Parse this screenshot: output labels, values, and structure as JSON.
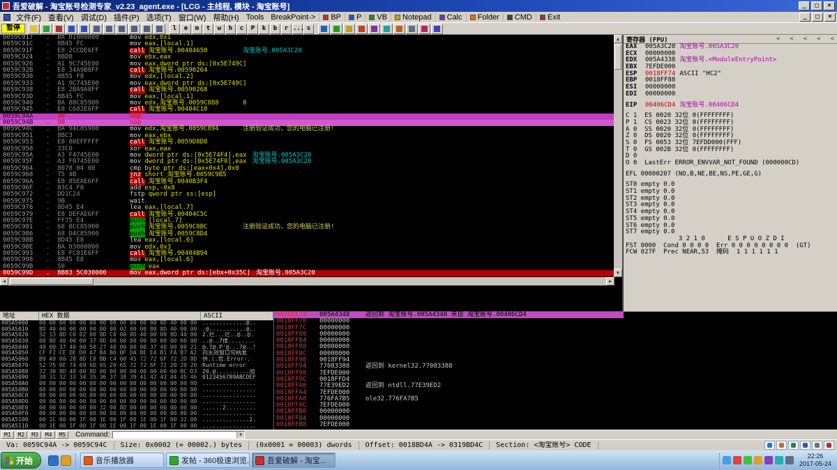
{
  "titlebar": {
    "title": "吾爱破解 - 淘宝账号检测专家_v2.23_agent.exe - [LCG - 主线程, 模块 - 淘宝账号]",
    "controls": [
      "_",
      "□",
      "×"
    ]
  },
  "menubar": {
    "menus": [
      "文件(F)",
      "查看(V)",
      "调试(D)",
      "插件(P)",
      "选项(T)",
      "窗口(W)",
      "帮助(H)",
      "Tools",
      "BreakPoint->"
    ],
    "shortcuts": [
      "BP",
      "P",
      "VB",
      "Notepad",
      "Calc",
      "Folder",
      "CMD",
      "Exit"
    ],
    "controls": [
      "_",
      "□",
      "×"
    ]
  },
  "toolbar": {
    "state_label": "暂停",
    "nav_icons": [
      "open-icon",
      "restart-icon",
      "close-icon",
      "run-icon",
      "pause-icon",
      "step-into-icon",
      "step-over-icon",
      "trace-into-icon",
      "trace-over-icon",
      "until-return-icon",
      "goto-icon"
    ],
    "letters": [
      "l",
      "e",
      "m",
      "t",
      "w",
      "h",
      "c",
      "P",
      "k",
      "b",
      "r",
      "...",
      "s"
    ],
    "plugin_icons": [
      "plugin-1-icon",
      "plugin-2-icon",
      "plugin-3-icon",
      "plugin-4-icon",
      "plugin-5-icon",
      "plugin-6-icon",
      "plugin-7-icon",
      "plugin-8-icon",
      "plugin-9-icon",
      "plugin-10-icon"
    ]
  },
  "disasm": {
    "rows": [
      {
        "a": "0059C917",
        "b": ".  BA 01000000",
        "m": "mov",
        "o": "edx,0x1"
      },
      {
        "a": "0059C91C",
        "b": ".  8B45 FC",
        "m": "mov",
        "o": "eax,[local.1]"
      },
      {
        "a": "0059C91F",
        "b": ".  E8 2CCDE6FF",
        "m": "call",
        "o": "淘宝账号.00404650",
        "c": "淘宝账号.005A3C20",
        "cc": "auto",
        "ty": "call"
      },
      {
        "a": "0059C924",
        "b": ".  8BD8",
        "m": "mov",
        "o": "ebx,eax"
      },
      {
        "a": "0059C926",
        "b": ".  A1 9C745E00",
        "m": "mov",
        "o": "eax,dword ptr ds:[0x5E749C]"
      },
      {
        "a": "0059C92B",
        "b": ".  E8 34A9B8FF",
        "m": "call",
        "o": "淘宝账号.00590264",
        "ty": "call"
      },
      {
        "a": "0059C930",
        "b": ".  8B55 F8",
        "m": "mov",
        "o": "edx,[local.2]"
      },
      {
        "a": "0059C933",
        "b": ".  A1 9C745E00",
        "m": "mov",
        "o": "eax,dword ptr ds:[0x5E749C]"
      },
      {
        "a": "0059C938",
        "b": ".  E8 2BA9A8FF",
        "m": "call",
        "o": "淘宝账号.00590268",
        "ty": "call"
      },
      {
        "a": "0059C93D",
        "b": ".  8B45 FC",
        "m": "mov",
        "o": "eax,[local.1]"
      },
      {
        "a": "0059C940",
        "b": ".  BA 88C85900",
        "m": "mov",
        "o": "edx,淘宝账号.0059C888",
        "c": "0",
        "cc": "str"
      },
      {
        "a": "0059C945",
        "b": ".  E8 C682E6FF",
        "m": "call",
        "o": "淘宝账号.00404C10",
        "ty": "call"
      },
      {
        "a": "0059C94A",
        "b": "   90",
        "m": "nop",
        "o": "",
        "ty": "sel1"
      },
      {
        "a": "0059C94B",
        "b": ".  90",
        "m": "nop",
        "o": "",
        "ty": "sel2"
      },
      {
        "a": "0059C94C",
        "b": ".  BA 94C85900",
        "m": "mov",
        "o": "edx,淘宝账号.0059C894",
        "c": "注册验证成功，您的电脑已注册!",
        "cc": "str"
      },
      {
        "a": "0059C951",
        "b": ".  8BC3",
        "m": "mov",
        "o": "eax,ebx"
      },
      {
        "a": "0059C953",
        "b": ".  E8 80EFFFFF",
        "m": "call",
        "o": "淘宝账号.0059D8D8",
        "ty": "call"
      },
      {
        "a": "0059C958",
        "b": ".  33C0",
        "m": "xor",
        "o": "eax,eax"
      },
      {
        "a": "0059C95A",
        "b": ".  A3 F4745E00",
        "m": "mov",
        "o": "dword ptr ds:[0x5E74F4],eax",
        "c": "淘宝账号.005A3C20",
        "cc": "auto"
      },
      {
        "a": "0059C95F",
        "b": ".  A3 F0745E00",
        "m": "mov",
        "o": "dword ptr ds:[0x5E74F0],eax",
        "c": "淘宝账号.005A3C20",
        "cc": "auto"
      },
      {
        "a": "0059C964",
        "b": ".  8078 04 00",
        "m": "cmp",
        "o": "byte ptr ds:[eax+0x4],0x0"
      },
      {
        "a": "0059C968",
        "b": ".  75 4B",
        "m": "jnz",
        "o": "short 淘宝账号.0059C9B5",
        "ty": "jmp"
      },
      {
        "a": "0059C96A",
        "b": ".  E8 85EAE6FF",
        "m": "call",
        "o": "淘宝账号.0040B3F4",
        "ty": "call"
      },
      {
        "a": "0059C96F",
        "b": ".  83C4 F8",
        "m": "add",
        "o": "esp,-0x8"
      },
      {
        "a": "0059C972",
        "b": ".  DD1C24",
        "m": "fstp",
        "o": "qword ptr ss:[esp]"
      },
      {
        "a": "0059C975",
        "b": ".  9B",
        "m": "wait",
        "o": ""
      },
      {
        "a": "0059C976",
        "b": ".  8D45 E4",
        "m": "lea",
        "o": "eax,[local.7]"
      },
      {
        "a": "0059C979",
        "b": ".  E8 DEFAE6FF",
        "m": "call",
        "o": "淘宝账号.00404C5C",
        "ty": "call"
      },
      {
        "a": "0059C97E",
        "b": ".  FF75 E4",
        "m": "push",
        "o": "[local.7]",
        "ty": "push"
      },
      {
        "a": "0059C981",
        "b": ".  68 BCC85900",
        "m": "push",
        "o": "淘宝账号.0059C8BC",
        "c": "注册验证成功，您的电脑已注册!",
        "cc": "str",
        "ty": "push"
      },
      {
        "a": "0059C986",
        "b": ".  68 D4C85900",
        "m": "push",
        "o": "淘宝账号.0059C8D4",
        "ty": "push"
      },
      {
        "a": "0059C98B",
        "b": ".  8D45 E8",
        "m": "lea",
        "o": "eax,[local.6]"
      },
      {
        "a": "0059C98E",
        "b": ".  BA 03000000",
        "m": "mov",
        "o": "edx,0x3"
      },
      {
        "a": "0059C993",
        "b": ".  E8 FC81E6FF",
        "m": "call",
        "o": "淘宝账号.00404B94",
        "ty": "call"
      },
      {
        "a": "0059C998",
        "b": ".  8B45 E8",
        "m": "mov",
        "o": "eax,[local.6]"
      },
      {
        "a": "0059C99B",
        "b": ".  50",
        "m": "push",
        "o": "eax",
        "ty": "push"
      },
      {
        "a": "0059C99D",
        "b": ".  8B83 5C030000",
        "m": "mov",
        "o": "eax,dword ptr ds:[ebx+0x35C]",
        "c": "淘宝账号.005A3C20",
        "ty": "bp"
      }
    ]
  },
  "registers": {
    "header": "寄存器 (FPU)",
    "pane_buttons": [
      "<",
      "<",
      "<",
      "<",
      "<"
    ],
    "lines": [
      {
        "n": "EAX",
        "v": "005A3C20",
        "c": "淘宝账号.005A3C20",
        "cc": "m"
      },
      {
        "n": "ECX",
        "v": "00000000"
      },
      {
        "n": "EDX",
        "v": "005A4338",
        "c": "淘宝账号.<ModuleEntryPoint>",
        "cc": "m"
      },
      {
        "n": "EBX",
        "v": "7EFDE000"
      },
      {
        "n": "ESP",
        "v": "0018FF74",
        "vc": "r",
        "c": "ASCII \"HC2\""
      },
      {
        "n": "EBP",
        "v": "0018FF88"
      },
      {
        "n": "ESI",
        "v": "00000000"
      },
      {
        "n": "EDI",
        "v": "00000000"
      },
      {
        "sp": 1
      },
      {
        "n": "EIP",
        "v": "00406CD4",
        "vc": "r",
        "c": "淘宝账号.00406CD4",
        "cc": "m"
      },
      {
        "sp": 1
      },
      {
        "t": "C 1  ES 0020 32位 0(FFFFFFFF)"
      },
      {
        "t": "P 1  CS 0023 32位 0(FFFFFFFF)"
      },
      {
        "t": "A 0  SS 0020 32位 0(FFFFFFFF)"
      },
      {
        "t": "Z 0  DS 0020 32位 0(FFFFFFFF)"
      },
      {
        "t": "S 0  FS 0053 32位 7EFDD000(FFF)"
      },
      {
        "t": "T 0  GS 002B 32位 0(FFFFFFFF)"
      },
      {
        "t": "D 0"
      },
      {
        "t": "O 0  LastErr ERROR_ENVVAR_NOT_FOUND (000000CD)"
      },
      {
        "sp": 1
      },
      {
        "t": "EFL 00000207 (NO,B,NE,BE,NS,PE,GE,G)"
      },
      {
        "sp": 1
      },
      {
        "t": "ST0 empty 0.0"
      },
      {
        "t": "ST1 empty 0.0"
      },
      {
        "t": "ST2 empty 0.0"
      },
      {
        "t": "ST3 empty 0.0"
      },
      {
        "t": "ST4 empty 0.0"
      },
      {
        "t": "ST5 empty 0.0"
      },
      {
        "t": "ST6 empty 0.0"
      },
      {
        "t": "ST7 empty 0.0"
      },
      {
        "t": "              3 2 1 0      E S P U O Z D I"
      },
      {
        "t": "FST 0000  Cond 0 0 0 0  Err 0 0 0 0 0 0 0 0  (GT)"
      },
      {
        "t": "FCW 027F  Prec NEAR,53  掩码  1 1 1 1 1 1"
      }
    ]
  },
  "dump": {
    "headers": [
      "地址",
      "HEX 数据",
      "ASCII"
    ],
    "rows": [
      [
        "005A5000",
        "00 00 00 00 00 00 00 00 00 00 00 00 8D 40 00 00",
        ".............@.."
      ],
      [
        "005A5010",
        "8D 40 00 00 00 00 00 00 02 00 00 00 8D 40 00 00",
        ".@...........@.."
      ],
      [
        "005A5020",
        "32 13 8D C0 02 00 8D C0 00 8D 40 00 00 8D 40 00",
        "2.烂...烂..@..@."
      ],
      [
        "005A5030",
        "00 8D 40 00 00 37 8D 00 00 00 00 00 00 00 00 00",
        "..@..7律........"
      ],
      [
        "005A5040",
        "40 00 37 40 00 50 27 40 00 00 00 37 40 00 00 21",
        "@.7@.P'@...7@..!"
      ],
      [
        "005A5050",
        "CF F2 CE DE D0 A7 B4 B0 BF DA BE E4 B1 FA B7 A2",
        "向无效窗口句柄发"
      ],
      [
        "005A5060",
        "B9 A9 00 28 8D C0 BB C4 00 45 72 72 6F 72 2D 8D",
        "供.(.荒.Error-."
      ],
      [
        "005A5070",
        "52 75 6E 74 69 6D 65 20 65 72 72 6F 72 20 20 20",
        "Runtime error   "
      ],
      [
        "005A5080",
        "32 30 8D 40 00 8D 00 00 00 00 00 00 00 00 BC D3",
        "20.@..........加"
      ],
      [
        "005A5090",
        "30 31 32 33 34 35 36 37 38 39 41 42 43 44 45 46",
        "0123456789ABCDEF"
      ],
      [
        "005A50A0",
        "00 00 00 00 00 00 00 00 00 00 00 00 00 00 00 00",
        "................"
      ],
      [
        "005A50B0",
        "00 00 00 00 00 00 00 00 00 00 00 00 00 00 00 00",
        "................"
      ],
      [
        "005A50C0",
        "00 00 00 00 00 00 00 00 00 00 00 00 00 00 00 00",
        "................"
      ],
      [
        "005A50D0",
        "00 00 00 00 00 00 00 00 00 00 00 00 00 00 00 00",
        "................"
      ],
      [
        "005A50E0",
        "00 00 00 00 00 00 32 00 8D 00 00 00 00 00 00 00",
        "......2........."
      ],
      [
        "005A50F0",
        "00 00 00 00 00 00 00 00 00 00 00 00 00 00 00 00",
        "................"
      ],
      [
        "005A5100",
        "00 1C 00 00 1F 00 1E 00 1F 00 1E 00 1F 00 32 00",
        "..............2."
      ],
      [
        "005A5110",
        "00 1E 00 1F 00 1F 00 1E 00 1F 00 1E 00 1F 00 00",
        "................"
      ]
    ]
  },
  "stack": {
    "rows": [
      [
        "0018FF74",
        "005A4348",
        "返回到 淘宝账号.005A4348 来自 淘宝账号.00406CD4",
        1
      ],
      [
        "0018FF78",
        "00000000",
        "",
        0
      ],
      [
        "0018FF7C",
        "00000000",
        "",
        0
      ],
      [
        "0018FF80",
        "00000000",
        "",
        0
      ],
      [
        "0018FF84",
        "00000000",
        "",
        0
      ],
      [
        "0018FF88",
        "00000000",
        "",
        0
      ],
      [
        "0018FF8C",
        "00000000",
        "",
        0
      ],
      [
        "0018FF90",
        "0018FF94",
        "",
        0
      ],
      [
        "0018FF94",
        "77083388",
        "返回到 kernel32.77083388",
        0
      ],
      [
        "0018FF98",
        "7EFDE000",
        "",
        0
      ],
      [
        "0018FF9C",
        "0018FFD4",
        "",
        0
      ],
      [
        "0018FFA0",
        "77E39ED2",
        "返回到 ntdll.77E39ED2",
        0
      ],
      [
        "0018FFA4",
        "7EFDE000",
        "",
        0
      ],
      [
        "0018FFA8",
        "776FA7B5",
        "ole32.776FA7B5",
        0
      ],
      [
        "0018FFAC",
        "7EFDE000",
        "",
        0
      ],
      [
        "0018FFB0",
        "00000000",
        "",
        0
      ],
      [
        "0018FFB4",
        "00000000",
        "",
        0
      ],
      [
        "0018FFB8",
        "7EFDE000",
        "",
        0
      ]
    ]
  },
  "cmdbar": {
    "marks": [
      "M1",
      "M2",
      "M3",
      "M4",
      "M5"
    ],
    "label": "Command:",
    "input_value": ""
  },
  "statusbar": {
    "segments": [
      "Va: 0059C94A -> 0059C94C",
      "Size: 0x0002 (= 00002.) bytes",
      "(0x0001 = 00003) dwords",
      "Offset: 0018BD4A -> 0319BD4C",
      "Section: <淘宝账号> CODE"
    ],
    "icons": [
      "magnifier-icon",
      "pen-icon",
      "camera-icon",
      "monitor-icon",
      "settings-icon",
      "close-icon"
    ]
  },
  "taskbar": {
    "start": "开始",
    "quicklaunch": [
      "quicklaunch-browser-icon",
      "quicklaunch-media-icon"
    ],
    "tasks": [
      {
        "label": "音乐播放器",
        "active": false
      },
      {
        "label": "发帖 - 360极速浏览...",
        "active": false
      },
      {
        "label": "吾爱破解 - 淘宝...",
        "active": true
      }
    ],
    "tray_icons": [
      "tray-1-icon",
      "tray-2-icon",
      "tray-3-icon",
      "tray-4-icon",
      "tray-5-icon",
      "tray-6-icon",
      "tray-7-icon"
    ],
    "clock_time": "22:26",
    "clock_date": "2017-05-24"
  }
}
